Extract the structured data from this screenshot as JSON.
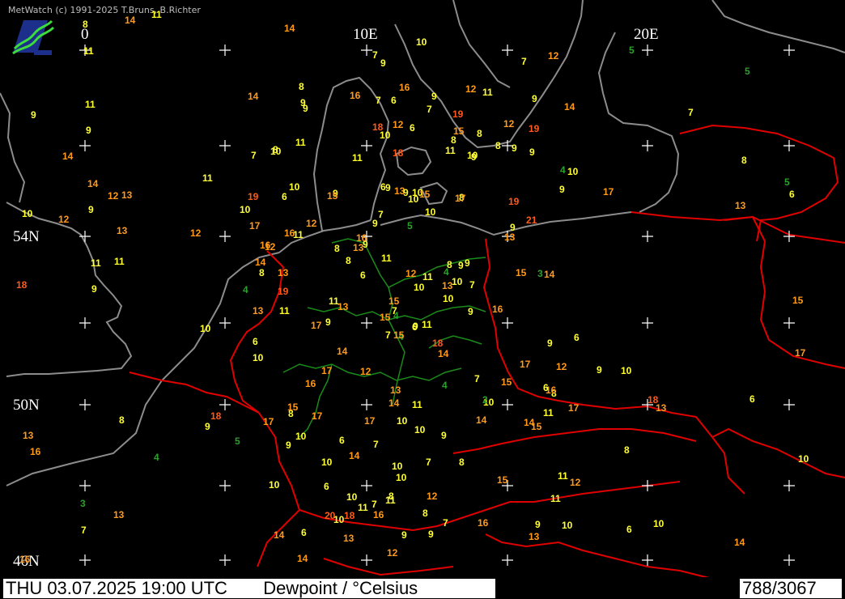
{
  "app": {
    "credit": "MetWatch  (c) 1991-2025 T.Bruns, B.Richter"
  },
  "map": {
    "longitude_labels": [
      "0",
      "10E",
      "20E"
    ],
    "latitude_labels": [
      "54N",
      "50N",
      "46N"
    ],
    "colors": {
      "background": "#000000",
      "coastline": "#8c8c8c",
      "border": "#e00000",
      "german_border": "#1a8c1a",
      "grid_cross": "#ffffff",
      "dewpoint_very_low": "#2ca02c",
      "dewpoint_low": "#ffff33",
      "dewpoint_mid": "#ff9a1a",
      "dewpoint_high": "#ff5a1a"
    },
    "observations": [
      {
        "v": "9"
      },
      {
        "v": "6"
      },
      {
        "v": "4"
      },
      {
        "v": "3"
      },
      {
        "v": "4"
      },
      {
        "v": "6"
      },
      {
        "v": "12"
      },
      {
        "v": "10"
      },
      {
        "v": "9"
      },
      {
        "v": "7"
      },
      {
        "v": "9"
      },
      {
        "v": "10"
      },
      {
        "v": "11"
      },
      {
        "v": "10"
      },
      {
        "v": "7"
      },
      {
        "v": "4"
      },
      {
        "v": "6"
      },
      {
        "v": "13"
      },
      {
        "v": "8"
      },
      {
        "v": "10"
      },
      {
        "v": "9"
      },
      {
        "v": "7"
      },
      {
        "v": "6"
      },
      {
        "v": "9"
      },
      {
        "v": "13"
      },
      {
        "v": "15"
      },
      {
        "v": "10"
      },
      {
        "v": "9"
      },
      {
        "v": "8"
      },
      {
        "v": "7"
      },
      {
        "v": "6"
      },
      {
        "v": "7"
      },
      {
        "v": "10"
      },
      {
        "v": "11"
      },
      {
        "v": "9"
      },
      {
        "v": "8"
      },
      {
        "v": "5"
      },
      {
        "v": "9"
      },
      {
        "v": "11"
      },
      {
        "v": "10"
      },
      {
        "v": "9"
      },
      {
        "v": "13"
      },
      {
        "v": "12"
      },
      {
        "v": "14"
      },
      {
        "v": "10"
      },
      {
        "v": "10"
      },
      {
        "v": "13"
      },
      {
        "v": "14"
      },
      {
        "v": "11"
      },
      {
        "v": "10"
      },
      {
        "v": "9"
      },
      {
        "v": "8"
      },
      {
        "v": "7"
      },
      {
        "v": "10"
      },
      {
        "v": "11"
      },
      {
        "v": "10"
      },
      {
        "v": "9"
      },
      {
        "v": "8"
      },
      {
        "v": "7"
      },
      {
        "v": "9"
      },
      {
        "v": "10"
      },
      {
        "v": "13"
      },
      {
        "v": "12"
      },
      {
        "v": "11"
      },
      {
        "v": "9"
      },
      {
        "v": "8"
      },
      {
        "v": "7"
      },
      {
        "v": "10"
      },
      {
        "v": "12"
      },
      {
        "v": "13"
      },
      {
        "v": "10"
      },
      {
        "v": "11"
      },
      {
        "v": "9"
      },
      {
        "v": "8"
      },
      {
        "v": "10"
      },
      {
        "v": "11"
      },
      {
        "v": "12"
      },
      {
        "v": "10"
      },
      {
        "v": "9"
      },
      {
        "v": "12"
      },
      {
        "v": "11"
      },
      {
        "v": "13"
      },
      {
        "v": "9"
      },
      {
        "v": "8"
      },
      {
        "v": "12"
      },
      {
        "v": "14"
      },
      {
        "v": "11"
      },
      {
        "v": "10"
      },
      {
        "v": "9"
      },
      {
        "v": "8"
      },
      {
        "v": "7"
      },
      {
        "v": "6"
      },
      {
        "v": "9"
      },
      {
        "v": "8"
      },
      {
        "v": "10"
      },
      {
        "v": "11"
      },
      {
        "v": "12"
      },
      {
        "v": "9"
      },
      {
        "v": "10"
      },
      {
        "v": "14"
      },
      {
        "v": "17"
      },
      {
        "v": "16"
      },
      {
        "v": "15"
      },
      {
        "v": "14"
      },
      {
        "v": "16"
      },
      {
        "v": "9"
      },
      {
        "v": "10"
      },
      {
        "v": "8"
      },
      {
        "v": "7"
      },
      {
        "v": "6"
      },
      {
        "v": "9"
      },
      {
        "v": "11"
      },
      {
        "v": "10"
      },
      {
        "v": "15"
      },
      {
        "v": "14"
      },
      {
        "v": "17"
      },
      {
        "v": "4"
      },
      {
        "v": "5"
      },
      {
        "v": "6"
      },
      {
        "v": "7"
      },
      {
        "v": "8"
      },
      {
        "v": "9"
      },
      {
        "v": "10"
      },
      {
        "v": "11"
      },
      {
        "v": "16"
      },
      {
        "v": "17"
      },
      {
        "v": "14"
      },
      {
        "v": "16"
      },
      {
        "v": "15"
      },
      {
        "v": "9"
      },
      {
        "v": "8"
      },
      {
        "v": "7"
      },
      {
        "v": "10"
      },
      {
        "v": "11"
      },
      {
        "v": "12"
      },
      {
        "v": "13"
      },
      {
        "v": "14"
      },
      {
        "v": "15"
      },
      {
        "v": "17"
      },
      {
        "v": "16"
      },
      {
        "v": "18"
      },
      {
        "v": "13"
      },
      {
        "v": "14"
      },
      {
        "v": "11"
      },
      {
        "v": "9"
      },
      {
        "v": "8"
      },
      {
        "v": "7"
      },
      {
        "v": "6"
      },
      {
        "v": "10"
      },
      {
        "v": "12"
      },
      {
        "v": "13"
      },
      {
        "v": "15"
      },
      {
        "v": "16"
      },
      {
        "v": "14"
      },
      {
        "v": "17"
      },
      {
        "v": "7"
      },
      {
        "v": "6"
      },
      {
        "v": "5"
      },
      {
        "v": "9"
      },
      {
        "v": "8"
      },
      {
        "v": "4"
      },
      {
        "v": "6"
      },
      {
        "v": "18"
      },
      {
        "v": "16"
      },
      {
        "v": "15"
      },
      {
        "v": "14"
      },
      {
        "v": "13"
      },
      {
        "v": "12"
      },
      {
        "v": "11"
      },
      {
        "v": "13"
      },
      {
        "v": "15"
      },
      {
        "v": "16"
      },
      {
        "v": "17"
      },
      {
        "v": "19"
      },
      {
        "v": "21"
      },
      {
        "v": "18"
      },
      {
        "v": "11"
      },
      {
        "v": "17"
      },
      {
        "v": "19"
      },
      {
        "v": "16"
      },
      {
        "v": "14"
      },
      {
        "v": "6"
      },
      {
        "v": "8"
      },
      {
        "v": "9"
      },
      {
        "v": "10"
      },
      {
        "v": "11"
      },
      {
        "v": "12"
      },
      {
        "v": "13"
      },
      {
        "v": "14"
      },
      {
        "v": "15"
      },
      {
        "v": "16"
      },
      {
        "v": "17"
      },
      {
        "v": "18"
      },
      {
        "v": "19"
      },
      {
        "v": "10"
      },
      {
        "v": "8"
      },
      {
        "v": "11"
      },
      {
        "v": "9"
      },
      {
        "v": "18"
      },
      {
        "v": "17"
      },
      {
        "v": "19"
      },
      {
        "v": "5"
      },
      {
        "v": "7"
      },
      {
        "v": "4"
      },
      {
        "v": "17"
      },
      {
        "v": "13"
      },
      {
        "v": "15"
      },
      {
        "v": "16"
      },
      {
        "v": "14"
      },
      {
        "v": "12"
      },
      {
        "v": "10"
      },
      {
        "v": "9"
      },
      {
        "v": "8"
      },
      {
        "v": "6"
      },
      {
        "v": "3"
      },
      {
        "v": "7"
      },
      {
        "v": "4"
      },
      {
        "v": "14"
      },
      {
        "v": "12"
      },
      {
        "v": "11"
      },
      {
        "v": "18"
      },
      {
        "v": "15"
      },
      {
        "v": "16"
      },
      {
        "v": "17"
      },
      {
        "v": "20"
      },
      {
        "v": "18"
      },
      {
        "v": "9"
      },
      {
        "v": "19"
      },
      {
        "v": "14"
      },
      {
        "v": "15"
      },
      {
        "v": "12"
      },
      {
        "v": "9"
      },
      {
        "v": "13"
      },
      {
        "v": "14"
      },
      {
        "v": "10"
      },
      {
        "v": "8"
      },
      {
        "v": "11"
      },
      {
        "v": "9"
      },
      {
        "v": "6"
      },
      {
        "v": "2"
      },
      {
        "v": "5"
      },
      {
        "v": "6"
      },
      {
        "v": "11"
      },
      {
        "v": "13"
      },
      {
        "v": "10"
      },
      {
        "v": "9"
      }
    ]
  },
  "status": {
    "datetime": "THU 03.07.2025 19:00 UTC",
    "parameter": "Dewpoint / °Celsius",
    "counter": "788/3067"
  }
}
